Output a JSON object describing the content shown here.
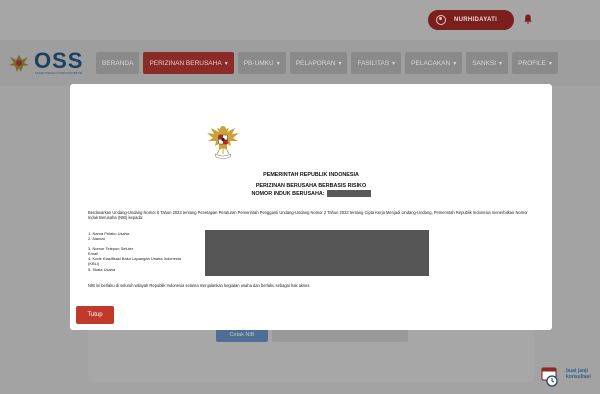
{
  "header": {
    "user_name": "NURHIDAYATI",
    "bell_icon": "bell-icon",
    "user_icon": "user-circle-icon"
  },
  "brand": {
    "logo_text": "OSS",
    "logo_sub": "KEMENTERIAN INVESTASI/BKPM"
  },
  "nav": {
    "items": [
      {
        "label": "BERANDA",
        "active": false,
        "chevron": false
      },
      {
        "label": "PERIZINAN BERUSAHA",
        "active": true,
        "chevron": true
      },
      {
        "label": "PB-UMKU",
        "active": false,
        "chevron": true
      },
      {
        "label": "PELAPORAN",
        "active": false,
        "chevron": true
      },
      {
        "label": "FASILITAS",
        "active": false,
        "chevron": true
      },
      {
        "label": "PELACAKAN",
        "active": false,
        "chevron": true
      },
      {
        "label": "SANKSI",
        "active": false,
        "chevron": true
      },
      {
        "label": "PROFILE",
        "active": false,
        "chevron": true
      }
    ]
  },
  "background": {
    "cetak_label": "Cetak NIB"
  },
  "chat": {
    "line1": "buat janji",
    "line2": "konsultasi"
  },
  "modal": {
    "heading1": "PEMERINTAH REPUBLIK INDONESIA",
    "heading2": "PERIZINAN BERUSAHA BERBASIS RISIKO",
    "heading3": "NOMOR INDUK BERUSAHA:",
    "intro": "Berdasarkan Undang-Undang Nomor 6 Tahun 2023 tentang Penetapan Peraturan Pemerintah Pengganti Undang-Undang Nomor 2 Tahun 2022 tentang Cipta Kerja Menjadi Undang-Undang, Pemerintah Republik Indonesia menerbitkan Nomor Induk Berusaha (NIB) kepada:",
    "fields": [
      "1. Nama Pelaku Usaha",
      "2. Alamat",
      "",
      "3. Nomor Telepon Seluler",
      "    Email",
      "4. Kode Klasifikasi Baku Lapangan Usaha Indonesia",
      "    (KBLI)",
      "5. Skala Usaha"
    ],
    "closing": "NIB ini berlaku di seluruh wilayah Republik Indonesia selama menjalankan kegiatan usaha dan berlaku sebagai hak akses",
    "close_label": "Tutup"
  },
  "colors": {
    "accent_red": "#c0392b",
    "nav_active": "#8b2b27",
    "brand_navy": "#1c3f63"
  }
}
